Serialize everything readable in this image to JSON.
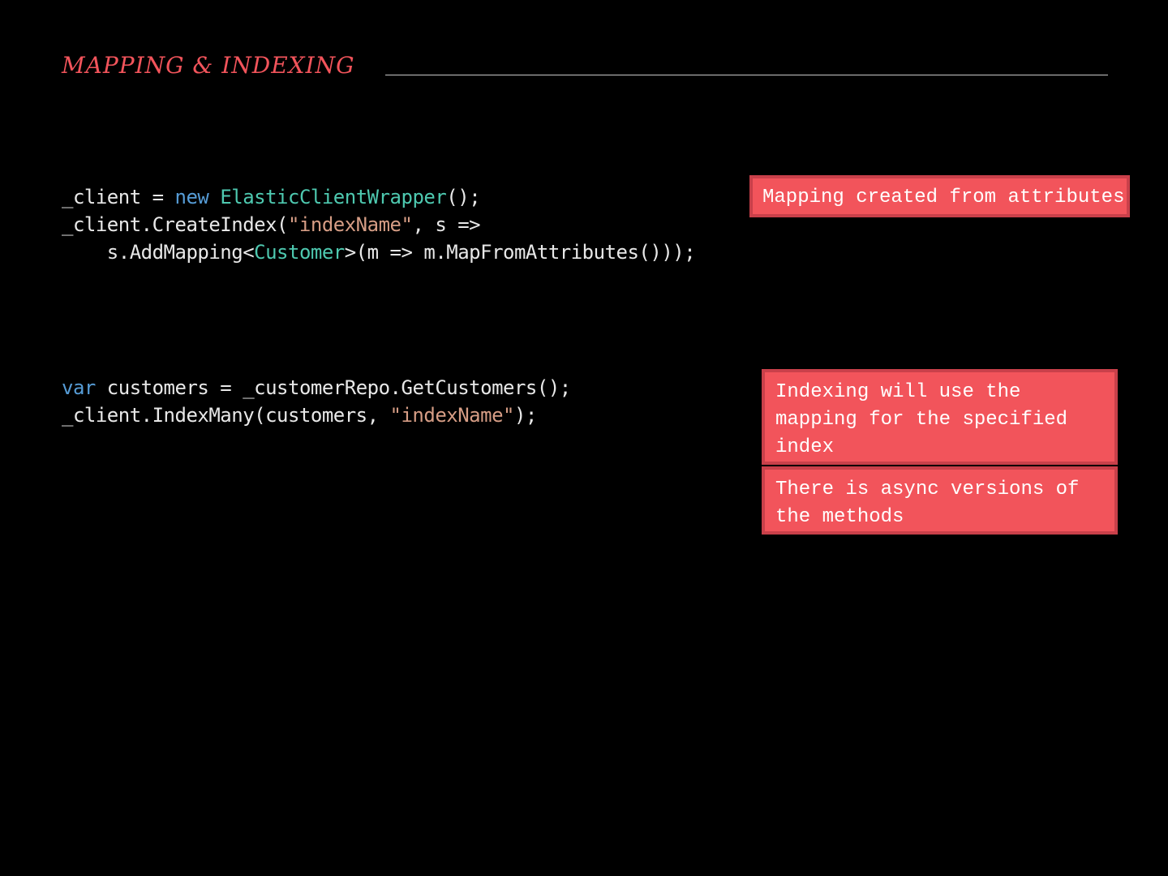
{
  "header": {
    "title": "MAPPING & INDEXING"
  },
  "code_blocks": [
    {
      "lines": [
        [
          {
            "t": "_client = ",
            "k": "plain"
          },
          {
            "t": "new",
            "k": "kw"
          },
          {
            "t": " ",
            "k": "plain"
          },
          {
            "t": "ElasticClientWrapper",
            "k": "type"
          },
          {
            "t": "();",
            "k": "plain"
          }
        ],
        [
          {
            "t": "_client.CreateIndex(",
            "k": "plain"
          },
          {
            "t": "\"indexName\"",
            "k": "str"
          },
          {
            "t": ", s =>",
            "k": "plain"
          }
        ],
        [
          {
            "t": "    s.AddMapping<",
            "k": "plain"
          },
          {
            "t": "Customer",
            "k": "type"
          },
          {
            "t": ">(m => m.MapFromAttributes()));",
            "k": "plain"
          }
        ]
      ]
    },
    {
      "lines": [
        [
          {
            "t": "var",
            "k": "kw"
          },
          {
            "t": " customers = _customerRepo.GetCustomers();",
            "k": "plain"
          }
        ],
        [
          {
            "t": "_client.IndexMany(customers, ",
            "k": "plain"
          },
          {
            "t": "\"indexName\"",
            "k": "str"
          },
          {
            "t": ");",
            "k": "plain"
          }
        ]
      ]
    }
  ],
  "callouts": [
    {
      "text": "Mapping created from attributes"
    },
    {
      "text": "Indexing will use the mapping for the specified index"
    },
    {
      "text": "There is async versions of the methods"
    }
  ],
  "colors": {
    "background": "#000000",
    "accent": "#f2545b",
    "callout_border": "#c9404a",
    "keyword": "#569cd6",
    "type": "#4ec9b0",
    "string": "#d69d85",
    "code_text": "#e8e8e8"
  }
}
